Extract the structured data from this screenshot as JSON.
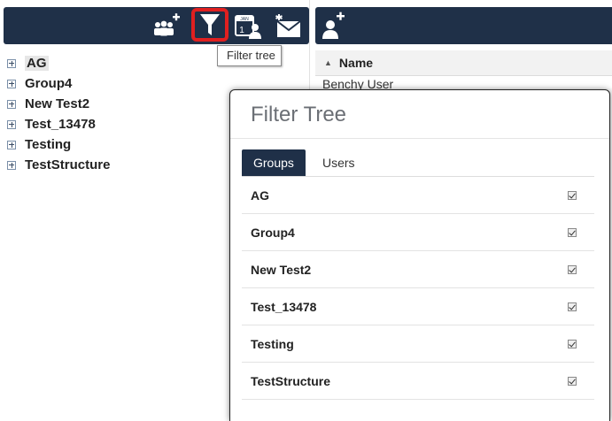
{
  "tooltip": "Filter tree",
  "calendar_icon_text": {
    "month": "JAN",
    "day": "1"
  },
  "tree": {
    "items": [
      {
        "label": "AG",
        "selected": true
      },
      {
        "label": "Group4",
        "selected": false
      },
      {
        "label": "New Test2",
        "selected": false
      },
      {
        "label": "Test_13478",
        "selected": false
      },
      {
        "label": "Testing",
        "selected": false
      },
      {
        "label": "TestStructure",
        "selected": false
      }
    ]
  },
  "list": {
    "column_header": "Name",
    "sort": "ascending",
    "first_row": "Benchy User"
  },
  "modal": {
    "title": "Filter Tree",
    "tabs": [
      {
        "label": "Groups",
        "active": true
      },
      {
        "label": "Users",
        "active": false
      }
    ],
    "groups": [
      {
        "label": "AG",
        "checked": true
      },
      {
        "label": "Group4",
        "checked": true
      },
      {
        "label": "New Test2",
        "checked": true
      },
      {
        "label": "Test_13478",
        "checked": true
      },
      {
        "label": "Testing",
        "checked": true
      },
      {
        "label": "TestStructure",
        "checked": true
      }
    ]
  },
  "icons": [
    "add-group-icon",
    "filter-icon",
    "calendar-user-icon",
    "send-message-icon",
    "add-user-icon"
  ],
  "colors": {
    "toolbar": "#1f3048",
    "highlight": "#e02020",
    "active_tab": "#1f3048"
  }
}
